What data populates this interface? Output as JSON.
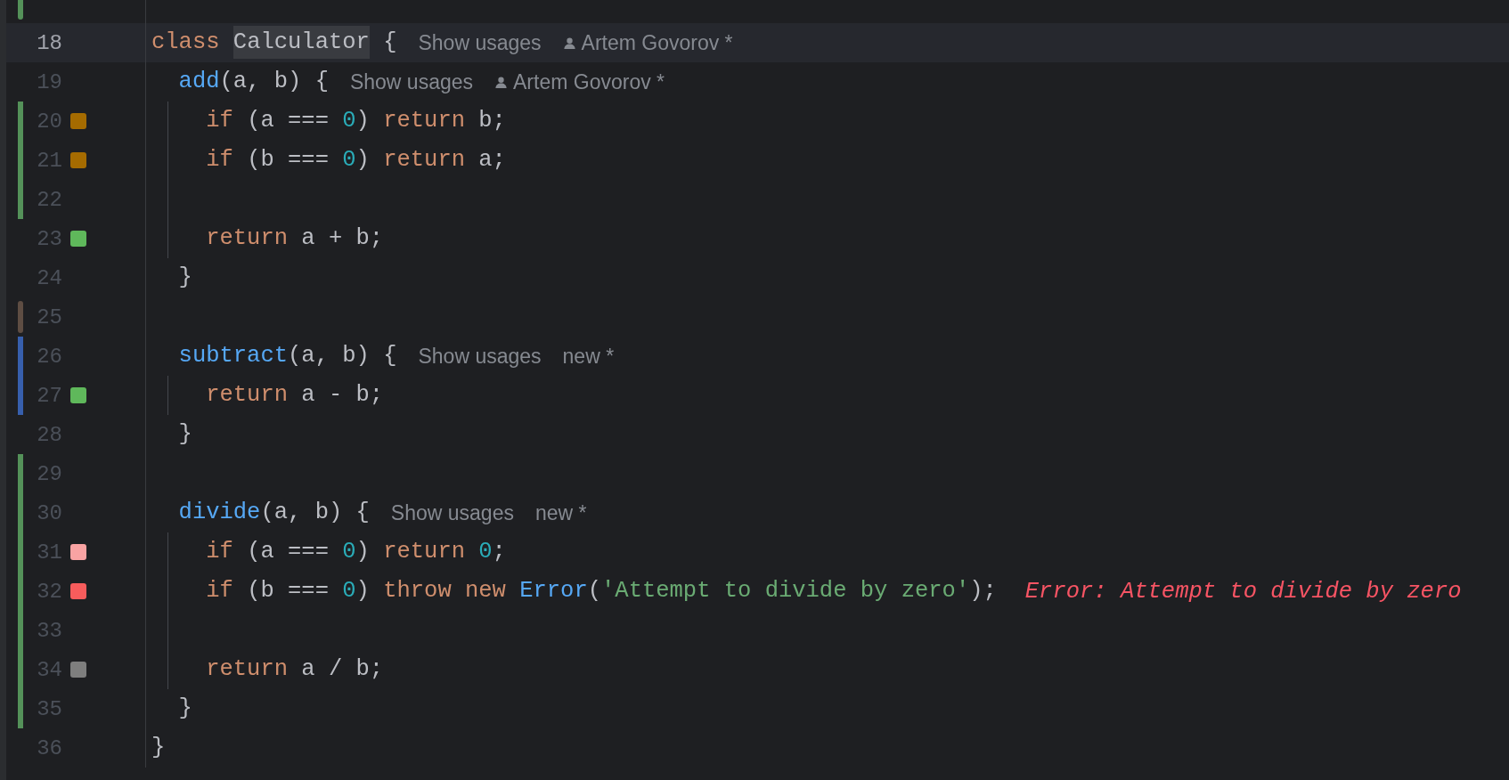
{
  "top_fragment": {
    "change_bar": {
      "color": "#549159"
    }
  },
  "lines": [
    {
      "number": "18",
      "current": true,
      "guide": false,
      "tokens": [
        {
          "kind": "keyword",
          "text": "class "
        },
        {
          "kind": "highlight",
          "text": "Calculator"
        },
        {
          "kind": "plain",
          "text": " {"
        }
      ],
      "inlays": [
        {
          "kind": "usages",
          "text": "Show usages"
        },
        {
          "kind": "author",
          "text": "Artem Govorov *"
        }
      ]
    },
    {
      "number": "19",
      "current": false,
      "guide": false,
      "tokens": [
        {
          "kind": "function",
          "text": "  add"
        },
        {
          "kind": "plain",
          "text": "(a, b) {"
        }
      ],
      "inlays": [
        {
          "kind": "usages",
          "text": "Show usages"
        },
        {
          "kind": "author",
          "text": "Artem Govorov *"
        }
      ]
    },
    {
      "number": "20",
      "current": false,
      "guide": true,
      "change_bar": {
        "color": "#549159"
      },
      "coverage": {
        "color": "#a56b00"
      },
      "tokens": [
        {
          "kind": "keyword",
          "text": "    if"
        },
        {
          "kind": "plain",
          "text": " (a === "
        },
        {
          "kind": "number",
          "text": "0"
        },
        {
          "kind": "plain",
          "text": ") "
        },
        {
          "kind": "keyword",
          "text": "return"
        },
        {
          "kind": "plain",
          "text": " b;"
        }
      ]
    },
    {
      "number": "21",
      "current": false,
      "guide": true,
      "change_bar": {
        "color": "#549159"
      },
      "coverage": {
        "color": "#a56b00"
      },
      "tokens": [
        {
          "kind": "keyword",
          "text": "    if"
        },
        {
          "kind": "plain",
          "text": " (b === "
        },
        {
          "kind": "number",
          "text": "0"
        },
        {
          "kind": "plain",
          "text": ") "
        },
        {
          "kind": "keyword",
          "text": "return"
        },
        {
          "kind": "plain",
          "text": " a;"
        }
      ]
    },
    {
      "number": "22",
      "current": false,
      "guide": true,
      "change_bar": {
        "color": "#549159"
      }
    },
    {
      "number": "23",
      "current": false,
      "guide": true,
      "coverage": {
        "color": "#5fb85b"
      },
      "tokens": [
        {
          "kind": "keyword",
          "text": "    return"
        },
        {
          "kind": "plain",
          "text": " a + b;"
        }
      ]
    },
    {
      "number": "24",
      "current": false,
      "guide": false,
      "tokens": [
        {
          "kind": "plain",
          "text": "  }"
        }
      ]
    },
    {
      "number": "25",
      "current": false,
      "guide": false,
      "change_bar": {
        "color": "#5e4d43"
      }
    },
    {
      "number": "26",
      "current": false,
      "guide": false,
      "change_bar": {
        "color": "#375fad"
      },
      "tokens": [
        {
          "kind": "function",
          "text": "  subtract"
        },
        {
          "kind": "plain",
          "text": "(a, b) {"
        }
      ],
      "inlays": [
        {
          "kind": "usages",
          "text": "Show usages"
        },
        {
          "kind": "new",
          "text": "new *"
        }
      ]
    },
    {
      "number": "27",
      "current": false,
      "guide": true,
      "change_bar": {
        "color": "#375fad"
      },
      "coverage": {
        "color": "#5fb85b"
      },
      "tokens": [
        {
          "kind": "keyword",
          "text": "    return"
        },
        {
          "kind": "plain",
          "text": " a - b;"
        }
      ]
    },
    {
      "number": "28",
      "current": false,
      "guide": false,
      "tokens": [
        {
          "kind": "plain",
          "text": "  }"
        }
      ]
    },
    {
      "number": "29",
      "current": false,
      "guide": false,
      "change_bar": {
        "color": "#549159"
      }
    },
    {
      "number": "30",
      "current": false,
      "guide": false,
      "change_bar": {
        "color": "#549159"
      },
      "tokens": [
        {
          "kind": "function",
          "text": "  divide"
        },
        {
          "kind": "plain",
          "text": "(a, b) {"
        }
      ],
      "inlays": [
        {
          "kind": "usages",
          "text": "Show usages"
        },
        {
          "kind": "new",
          "text": "new *"
        }
      ]
    },
    {
      "number": "31",
      "current": false,
      "guide": true,
      "change_bar": {
        "color": "#549159"
      },
      "coverage": {
        "color": "#f9a3a3"
      },
      "tokens": [
        {
          "kind": "keyword",
          "text": "    if"
        },
        {
          "kind": "plain",
          "text": " (a === "
        },
        {
          "kind": "number",
          "text": "0"
        },
        {
          "kind": "plain",
          "text": ") "
        },
        {
          "kind": "keyword",
          "text": "return "
        },
        {
          "kind": "number",
          "text": "0"
        },
        {
          "kind": "plain",
          "text": ";"
        }
      ]
    },
    {
      "number": "32",
      "current": false,
      "guide": true,
      "change_bar": {
        "color": "#549159"
      },
      "coverage": {
        "color": "#f75c5c"
      },
      "tokens": [
        {
          "kind": "keyword",
          "text": "    if"
        },
        {
          "kind": "plain",
          "text": " (b === "
        },
        {
          "kind": "number",
          "text": "0"
        },
        {
          "kind": "plain",
          "text": ") "
        },
        {
          "kind": "keyword",
          "text": "throw new "
        },
        {
          "kind": "function",
          "text": "Error"
        },
        {
          "kind": "plain",
          "text": "("
        },
        {
          "kind": "string",
          "text": "'Attempt to divide by zero'"
        },
        {
          "kind": "plain",
          "text": ");"
        }
      ],
      "inlays": [
        {
          "kind": "error",
          "text": "Error: Attempt to divide by zero"
        }
      ]
    },
    {
      "number": "33",
      "current": false,
      "guide": true,
      "change_bar": {
        "color": "#549159"
      }
    },
    {
      "number": "34",
      "current": false,
      "guide": true,
      "change_bar": {
        "color": "#549159"
      },
      "coverage": {
        "color": "#7e7e7e"
      },
      "tokens": [
        {
          "kind": "keyword",
          "text": "    return"
        },
        {
          "kind": "plain",
          "text": " a / b;"
        }
      ]
    },
    {
      "number": "35",
      "current": false,
      "guide": false,
      "change_bar": {
        "color": "#549159"
      },
      "tokens": [
        {
          "kind": "plain",
          "text": "  }"
        }
      ]
    },
    {
      "number": "36",
      "current": false,
      "guide": false,
      "tokens": [
        {
          "kind": "plain",
          "text": "}"
        }
      ]
    }
  ]
}
